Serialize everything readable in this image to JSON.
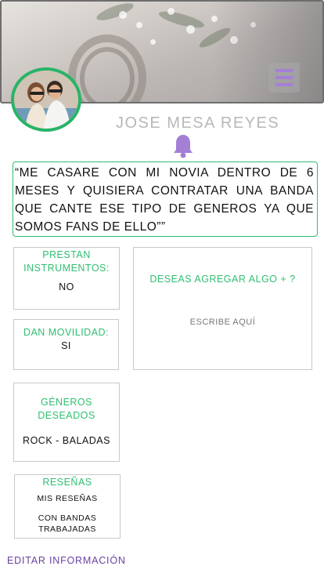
{
  "header": {
    "menu_icon": "hamburger-menu-icon"
  },
  "profile": {
    "name": "JOSE MESA REYES",
    "notification_icon": "bell-icon"
  },
  "request": {
    "text": "“ME CASARE CON MI NOVIA DENTRO DE 6 MESES Y QUISIERA CONTRATAR UNA BANDA QUE CANTE ESE TIPO DE GENEROS YA QUE SOMOS FANS DE ELLO””"
  },
  "cards": {
    "instruments": {
      "title": "PRESTAN INSTRUMENTOS:",
      "value": "NO"
    },
    "mobility": {
      "title": "DAN MOVILIDAD:",
      "value": "SI"
    },
    "add": {
      "title": "DESEAS AGREGAR ALGO + ?",
      "placeholder": "ESCRIBE AQUÍ"
    },
    "genres": {
      "title": "GÉNEROS DESEADOS",
      "value": "ROCK - BALADAS"
    },
    "reviews": {
      "title": "RESEÑAS",
      "my_reviews": "MIS RESEÑAS",
      "band_reviews": "CON BANDAS TRABAJADAS"
    }
  },
  "footer": {
    "edit_label": "EDITAR INFORMACIÓN"
  },
  "colors": {
    "accent_green": "#2fbf70",
    "accent_purple": "#a47fd6",
    "link_purple": "#6a3fa0"
  }
}
